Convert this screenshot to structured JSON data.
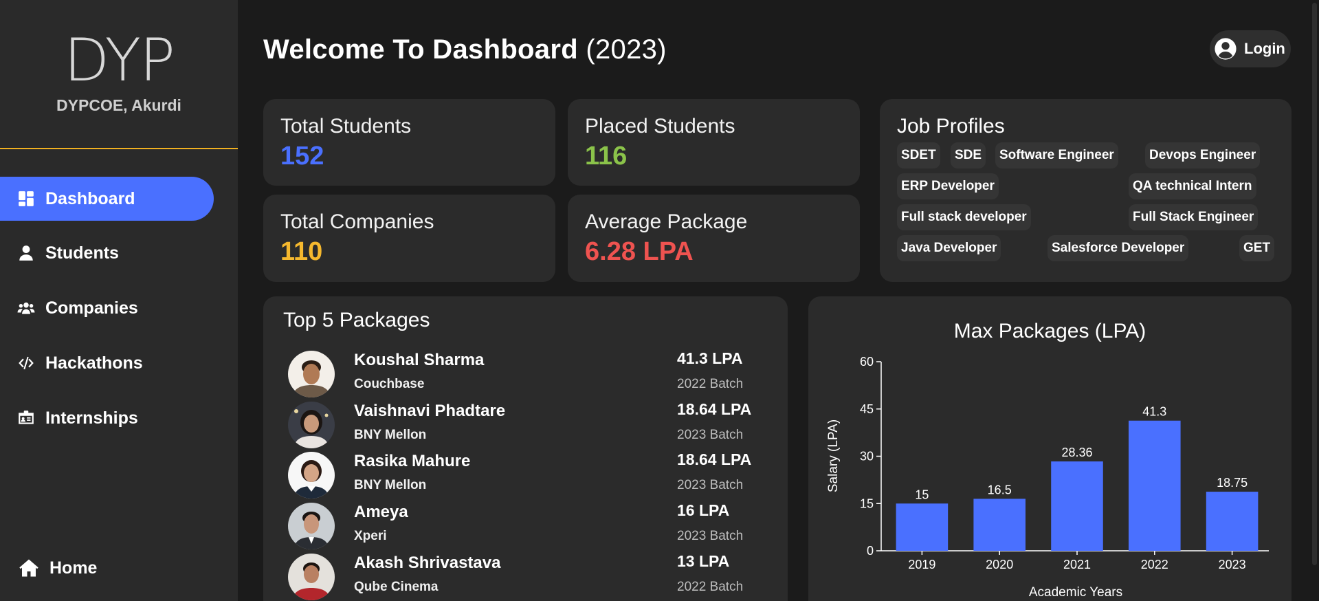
{
  "brand": {
    "logo_text": "DYP",
    "college": "DYPCOE, Akurdi",
    "accent": "#f0b020"
  },
  "nav": {
    "items": [
      {
        "label": "Dashboard",
        "icon": "dashboard-icon"
      },
      {
        "label": "Students",
        "icon": "user-icon"
      },
      {
        "label": "Companies",
        "icon": "users-icon"
      },
      {
        "label": "Hackathons",
        "icon": "code-icon"
      },
      {
        "label": "Internships",
        "icon": "id-card-icon"
      }
    ],
    "home": {
      "label": "Home",
      "icon": "home-icon"
    },
    "active_color": "#4a70ff"
  },
  "header": {
    "title": "Welcome To Dashboard",
    "year": "(2023)",
    "login_label": "Login"
  },
  "stats": {
    "total_students": {
      "label": "Total Students",
      "value": "152",
      "color": "#4a70ff"
    },
    "placed_students": {
      "label": "Placed Students",
      "value": "116",
      "color": "#8bc34a"
    },
    "total_companies": {
      "label": "Total Companies",
      "value": "110",
      "color": "#f5b82e"
    },
    "average_package": {
      "label": "Average Package",
      "value": "6.28 LPA",
      "color": "#ef5350"
    }
  },
  "job_profiles": {
    "title": "Job Profiles",
    "items": [
      "SDET",
      "SDE",
      "Software Engineer",
      "Devops Engineer",
      "ERP Developer",
      "QA technical Intern",
      "Full stack developer",
      "Full Stack Engineer",
      "Java Developer",
      "Salesforce Developer",
      "GET"
    ]
  },
  "top_packages": {
    "title": "Top 5 Packages",
    "rows": [
      {
        "name": "Koushal Sharma",
        "company": "Couchbase",
        "amount": "41.3 LPA",
        "batch": "2022 Batch"
      },
      {
        "name": "Vaishnavi Phadtare",
        "company": "BNY Mellon",
        "amount": "18.64 LPA",
        "batch": "2023 Batch"
      },
      {
        "name": "Rasika Mahure",
        "company": "BNY Mellon",
        "amount": "18.64 LPA",
        "batch": "2023 Batch"
      },
      {
        "name": "Ameya",
        "company": "Xperi",
        "amount": "16 LPA",
        "batch": "2023 Batch"
      },
      {
        "name": "Akash Shrivastava",
        "company": "Qube Cinema",
        "amount": "13 LPA",
        "batch": "2022 Batch"
      }
    ]
  },
  "chart_data": {
    "type": "bar",
    "title": "Max Packages (LPA)",
    "categories": [
      "2019",
      "2020",
      "2021",
      "2022",
      "2023"
    ],
    "values": [
      15,
      16.5,
      28.36,
      41.3,
      18.75
    ],
    "data_labels": [
      "15",
      "16.5",
      "28.36",
      "41.3",
      "18.75"
    ],
    "xlabel": "Academic Years",
    "ylabel": "Salary (LPA)",
    "ylim": [
      0,
      60
    ],
    "yticks": [
      "0",
      "15",
      "30",
      "45",
      "60"
    ],
    "grid": false,
    "bar_color": "#4a70ff"
  }
}
